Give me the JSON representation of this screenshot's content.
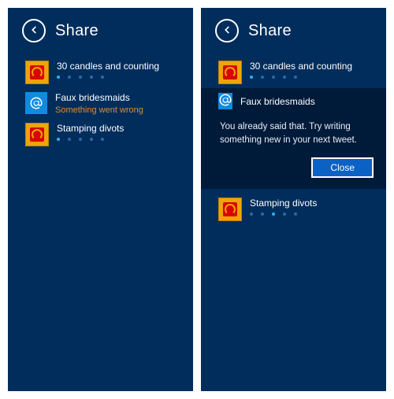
{
  "left": {
    "title": "Share",
    "items": [
      {
        "name": "30 candles and counting",
        "icon": "orange",
        "progress": 0,
        "dots": 5
      },
      {
        "name": "Faux bridesmaids",
        "icon": "blue",
        "error": "Something went wrong"
      },
      {
        "name": "Stamping divots",
        "icon": "orange",
        "progress": 0,
        "dots": 5
      }
    ]
  },
  "right": {
    "title": "Share",
    "items": [
      {
        "name": "30 candles and counting",
        "icon": "orange",
        "progress": 0,
        "dots": 5
      },
      {
        "name": "Faux bridesmaids",
        "icon": "blue",
        "expanded": true,
        "message": "You already said that. Try writing something new in your next tweet.",
        "close_label": "Close"
      },
      {
        "name": "Stamping divots",
        "icon": "orange",
        "progress": 2,
        "dots": 5
      }
    ]
  }
}
